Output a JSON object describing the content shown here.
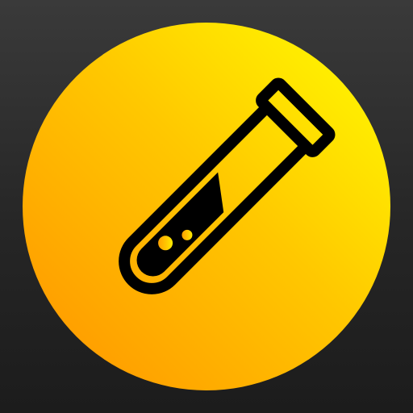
{
  "icon": {
    "name": "test-tube-app-icon",
    "glyph": "test-tube-icon",
    "colors": {
      "background_top": "#3a3a3a",
      "background_bottom": "#1c1c1c",
      "circle_highlight": "#ffff00",
      "circle_mid": "#ffc400",
      "circle_shadow": "#ff9a00",
      "glyph": "#000000"
    }
  }
}
